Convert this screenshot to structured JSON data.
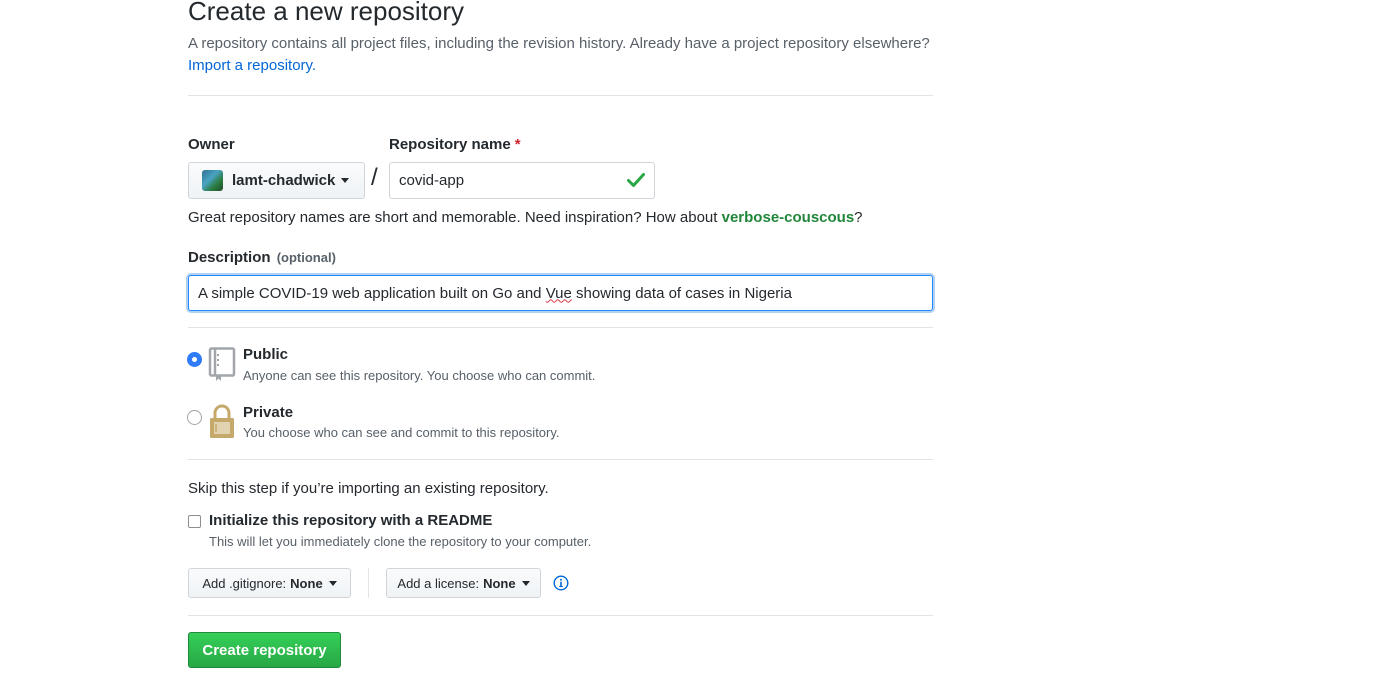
{
  "header": {
    "title": "Create a new repository",
    "description_text": "A repository contains all project files, including the revision history. Already have a project repository elsewhere?",
    "import_link": "Import a repository."
  },
  "owner": {
    "label": "Owner",
    "value": "lamt-chadwick",
    "separator": "/"
  },
  "repository_name": {
    "label": "Repository name",
    "required_mark": "*",
    "value": "covid-app"
  },
  "name_hint": {
    "text": "Great repository names are short and memorable. Need inspiration? How about",
    "suggestion": "verbose-couscous",
    "suffix": "?"
  },
  "description": {
    "label": "Description",
    "optional": "(optional)",
    "value_before": "A simple COVID-19 web application built on Go and ",
    "value_misspelled": "Vue",
    "value_after": " showing data of cases in Nigeria"
  },
  "visibility": {
    "public": {
      "title": "Public",
      "note": "Anyone can see this repository. You choose who can commit.",
      "selected": true
    },
    "private": {
      "title": "Private",
      "note": "You choose who can see and commit to this repository.",
      "selected": false
    }
  },
  "init": {
    "skip_text": "Skip this step if you’re importing an existing repository.",
    "readme_label": "Initialize this repository with a README",
    "readme_note": "This will let you immediately clone the repository to your computer.",
    "readme_checked": false
  },
  "gitignore": {
    "label": "Add .gitignore:",
    "value": "None"
  },
  "license": {
    "label": "Add a license:",
    "value": "None"
  },
  "submit": {
    "label": "Create repository"
  },
  "colors": {
    "link": "#0366d6",
    "success_green": "#28a745",
    "suggestion_green": "#22863a",
    "required_red": "#cb2431",
    "radio_blue": "#2f7cf6",
    "focus_blue": "#2188ff"
  }
}
